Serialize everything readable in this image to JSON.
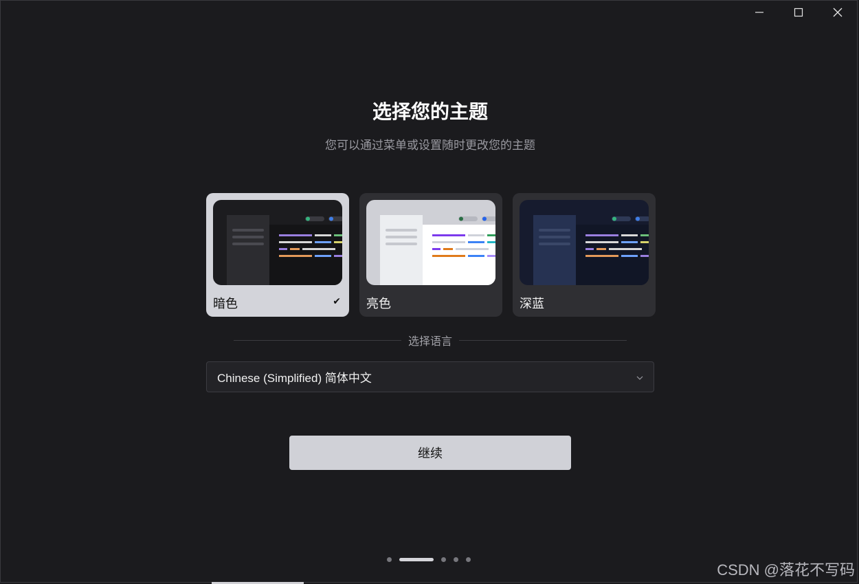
{
  "window": {
    "controls": [
      {
        "name": "minimize-icon"
      },
      {
        "name": "maximize-icon"
      },
      {
        "name": "close-icon"
      }
    ]
  },
  "header": {
    "title": "选择您的主题",
    "subtitle": "您可以通过菜单或设置随时更改您的主题"
  },
  "themes": [
    {
      "label": "暗色",
      "selected": true
    },
    {
      "label": "亮色",
      "selected": false
    },
    {
      "label": "深蓝",
      "selected": false
    }
  ],
  "language": {
    "section_label": "选择语言",
    "selected_value": "Chinese (Simplified) 简体中文"
  },
  "actions": {
    "continue_label": "继续"
  },
  "pager": {
    "total": 5,
    "active_index": 1
  },
  "watermark": "CSDN @落花不写码",
  "colors": {
    "background": "#1b1b1e",
    "card": "#2f2f33",
    "card_selected": "#d3d4da",
    "button": "#d0d1d7"
  }
}
